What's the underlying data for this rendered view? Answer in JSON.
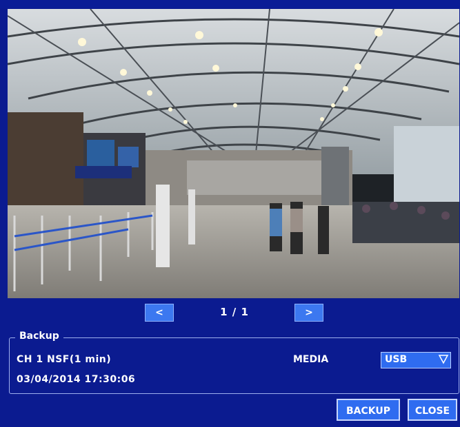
{
  "pager": {
    "prev_icon": "chevron-left-icon",
    "prev_glyph": "<",
    "page_label": "1 / 1",
    "next_icon": "chevron-right-icon",
    "next_glyph": ">"
  },
  "backup": {
    "title": "Backup",
    "channel_line": "CH 1 NSF(1 min)",
    "timestamp": "03/04/2014 17:30:06",
    "media_label": "MEDIA",
    "media_value": "USB"
  },
  "buttons": {
    "backup_label": "BACKUP",
    "close_label": "CLOSE"
  },
  "colors": {
    "background": "#0b1b90",
    "button": "#2f6cf0",
    "nav_button": "#3c78f0"
  }
}
